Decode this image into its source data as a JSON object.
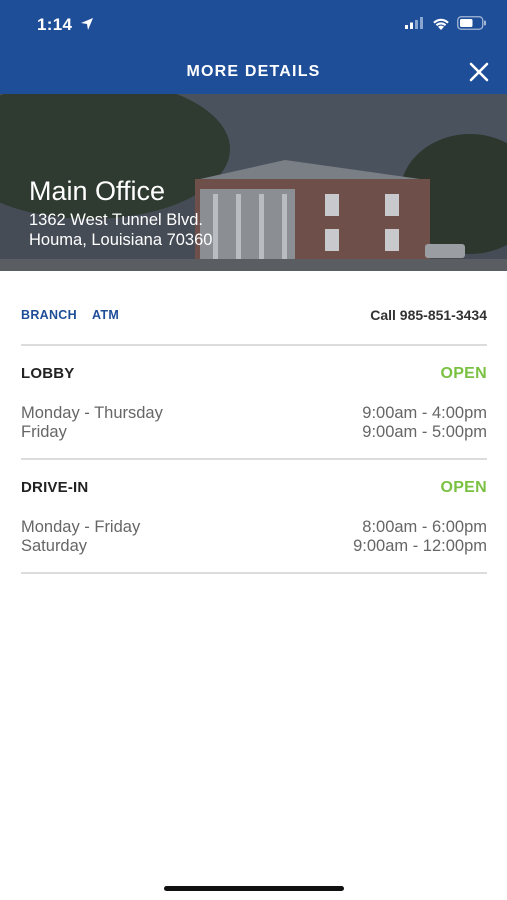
{
  "status_bar": {
    "time": "1:14"
  },
  "nav": {
    "title": "MORE DETAILS"
  },
  "hero": {
    "title": "Main Office",
    "address_line1": "1362 West Tunnel Blvd.",
    "address_line2": "Houma, Louisiana 70360"
  },
  "tabs": {
    "branch": "BRANCH",
    "atm": "ATM"
  },
  "call": "Call 985-851-3434",
  "sections": [
    {
      "title": "LOBBY",
      "status": "OPEN",
      "rows": [
        {
          "day": "Monday - Thursday",
          "time": "9:00am - 4:00pm"
        },
        {
          "day": "Friday",
          "time": "9:00am - 5:00pm"
        }
      ]
    },
    {
      "title": "DRIVE-IN",
      "status": "OPEN",
      "rows": [
        {
          "day": "Monday - Friday",
          "time": "8:00am - 6:00pm"
        },
        {
          "day": "Saturday",
          "time": "9:00am - 12:00pm"
        }
      ]
    }
  ],
  "colors": {
    "brand_blue": "#1f4e98",
    "open_green": "#7ac142"
  }
}
